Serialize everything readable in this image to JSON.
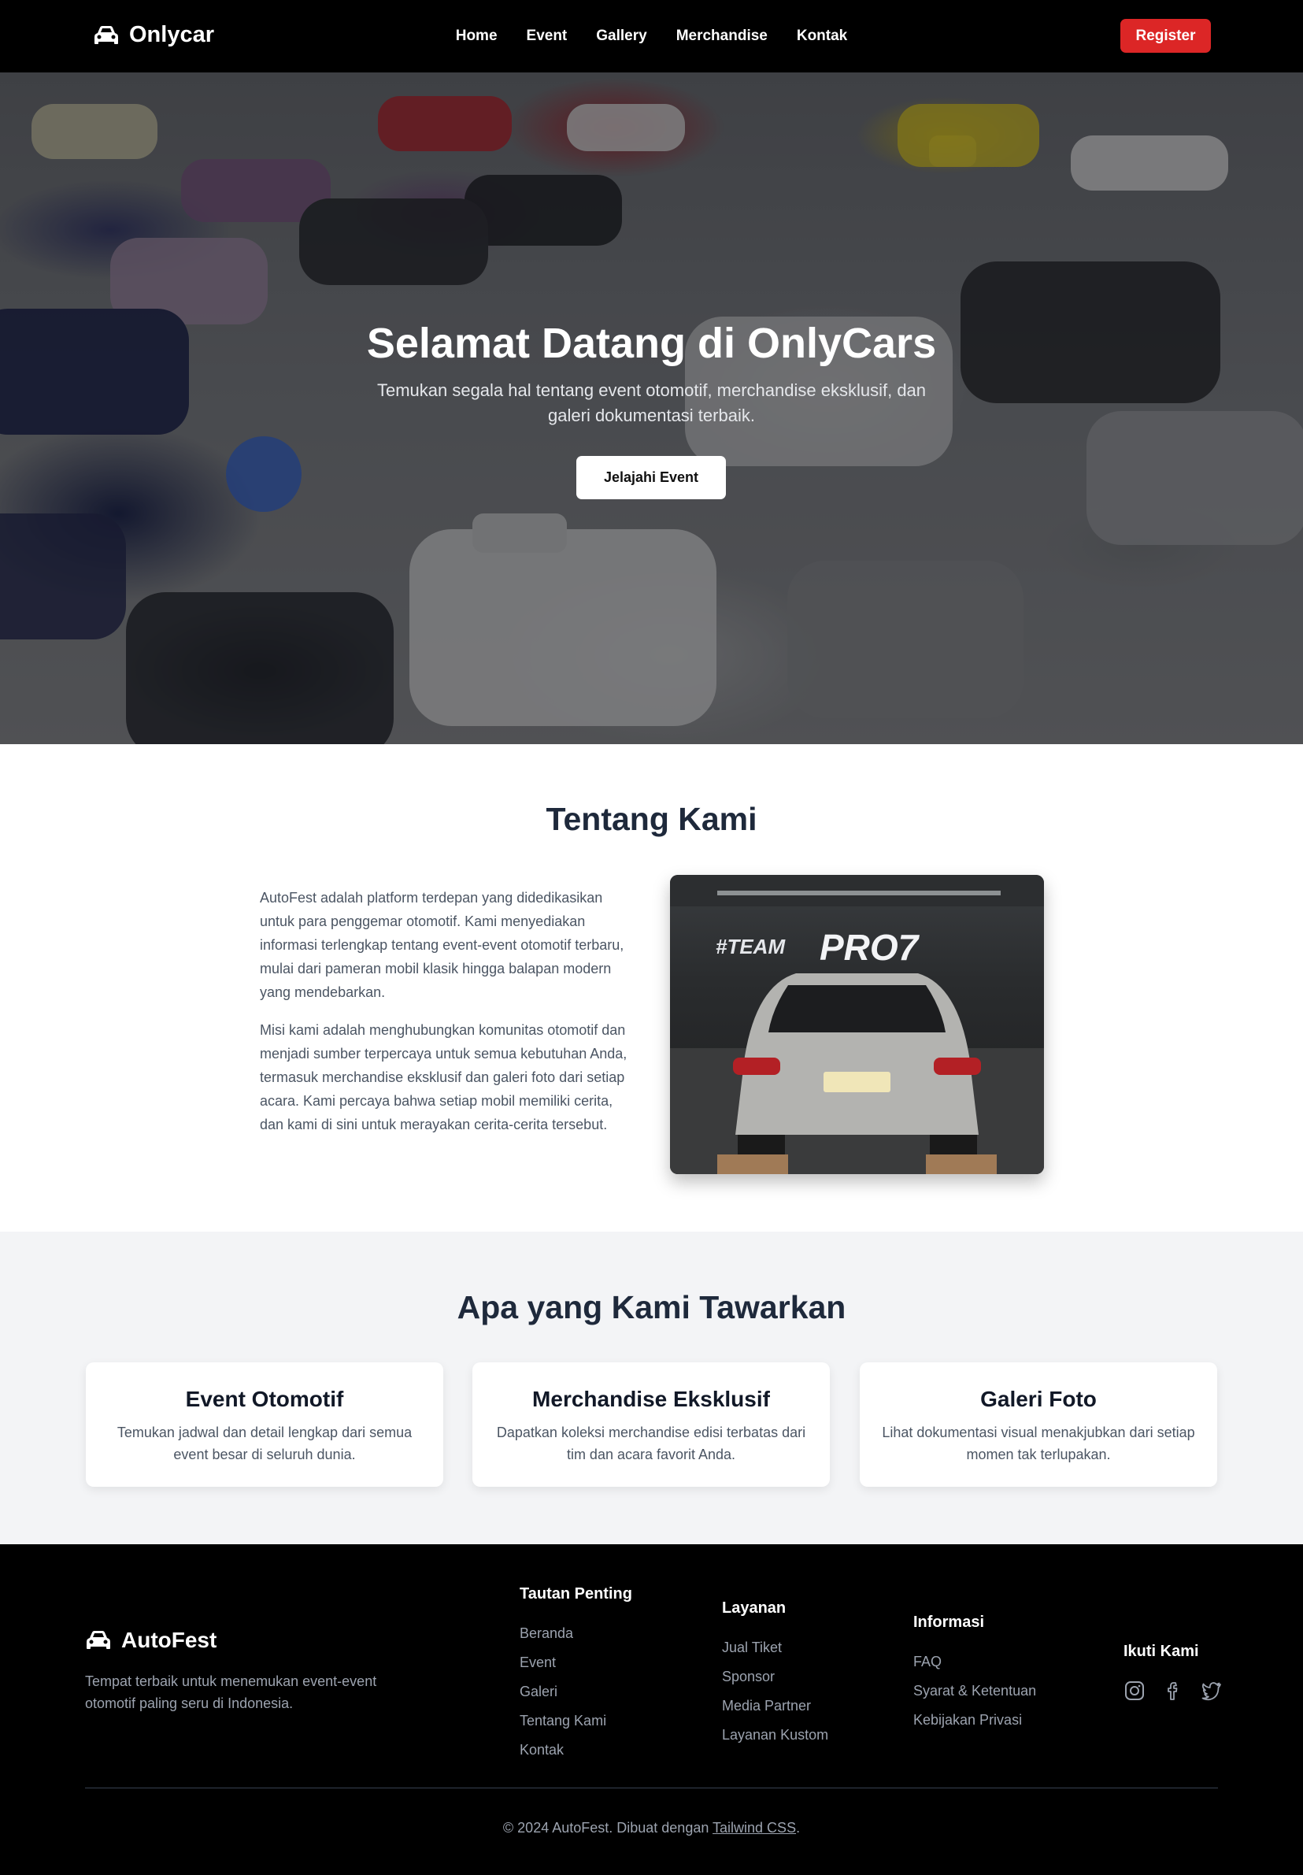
{
  "nav": {
    "brand": "Onlycar",
    "brand_icon": "car-icon",
    "items": [
      "Home",
      "Event",
      "Gallery",
      "Merchandise",
      "Kontak"
    ],
    "register": "Register",
    "register_color": "#dc2626"
  },
  "hero": {
    "title": "Selamat Datang di OnlyCars",
    "subtitle": "Temukan segala hal tentang event otomotif, merchandise eksklusif, dan galeri dokumentasi terbaik.",
    "cta": "Jelajahi Event"
  },
  "about": {
    "title": "Tentang Kami",
    "p1": "AutoFest adalah platform terdepan yang didedikasikan untuk para penggemar otomotif. Kami menyediakan informasi terlengkap tentang event-event otomotif terbaru, mulai dari pameran mobil klasik hingga balapan modern yang mendebarkan.",
    "p2": "Misi kami adalah menghubungkan komunitas otomotif dan menjadi sumber terpercaya untuk semua kebutuhan Anda, termasuk merchandise eksklusif dan galeri foto dari setiap acara. Kami percaya bahwa setiap mobil memiliki cerita, dan kami di sini untuk merayakan cerita-cerita tersebut.",
    "image_banner_a": "#TEAM",
    "image_banner_b": "PRO7"
  },
  "offer": {
    "title": "Apa yang Kami Tawarkan",
    "cards": [
      {
        "title": "Event Otomotif",
        "desc": "Temukan jadwal dan detail lengkap dari semua event besar di seluruh dunia."
      },
      {
        "title": "Merchandise Eksklusif",
        "desc": "Dapatkan koleksi merchandise edisi terbatas dari tim dan acara favorit Anda."
      },
      {
        "title": "Galeri Foto",
        "desc": "Lihat dokumentasi visual menakjubkan dari setiap momen tak terlupakan."
      }
    ]
  },
  "footer": {
    "brand": "AutoFest",
    "desc": "Tempat terbaik untuk menemukan event-event otomotif paling seru di Indonesia.",
    "col1": {
      "title": "Tautan Penting",
      "items": [
        "Beranda",
        "Event",
        "Galeri",
        "Tentang Kami",
        "Kontak"
      ]
    },
    "col2": {
      "title": "Layanan",
      "items": [
        "Jual Tiket",
        "Sponsor",
        "Media Partner",
        "Layanan Kustom"
      ]
    },
    "col3": {
      "title": "Informasi",
      "items": [
        "FAQ",
        "Syarat & Ketentuan",
        "Kebijakan Privasi"
      ]
    },
    "social_title": "Ikuti Kami",
    "social_icons": [
      "instagram-icon",
      "facebook-icon",
      "twitter-icon"
    ],
    "copyright_prefix": "© 2024 AutoFest. Dibuat dengan ",
    "copyright_link": "Tailwind CSS",
    "copyright_suffix": "."
  }
}
